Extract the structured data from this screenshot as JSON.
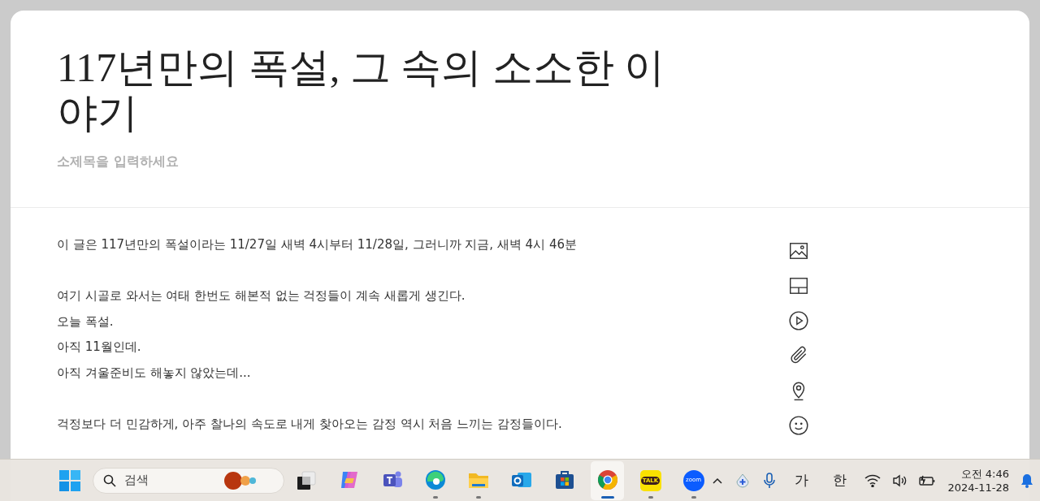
{
  "editor": {
    "title": "117년만의 폭설, 그 속의 소소한 이야기",
    "subtitle_placeholder": "소제목을 입력하세요",
    "paragraphs": [
      [
        "이 글은 117년만의 폭설이라는 11/27일 새벽 4시부터 11/28일, 그러니까 지금, 새벽 4시 46분"
      ],
      [
        "여기 시골로 와서는 여태 한번도 해본적 없는 걱정들이 계속 새롭게 생긴다.",
        "오늘 폭설.",
        "아직 11월인데.",
        "아직 겨울준비도 해놓지 않았는데..."
      ],
      [
        "걱정보다 더 민감하게, 아주 찰나의 속도로 내게 찾아오는 감정 역시 처음 느끼는 감정들이다."
      ]
    ]
  },
  "taskbar": {
    "search_placeholder": "검색",
    "apps": [
      {
        "kind": "taskview",
        "running": false,
        "selected": false
      },
      {
        "kind": "copilot",
        "running": false,
        "selected": false
      },
      {
        "kind": "teams",
        "running": false,
        "selected": false
      },
      {
        "kind": "edge",
        "running": true,
        "selected": false
      },
      {
        "kind": "explorer",
        "running": true,
        "selected": false
      },
      {
        "kind": "outlook",
        "running": false,
        "selected": false
      },
      {
        "kind": "store",
        "running": false,
        "selected": false
      },
      {
        "kind": "chrome",
        "running": true,
        "selected": true
      },
      {
        "kind": "kakao",
        "label": "TALK",
        "running": true,
        "selected": false
      },
      {
        "kind": "zoom",
        "label": "zoom",
        "running": true,
        "selected": false
      }
    ],
    "ime": [
      "가",
      "한"
    ],
    "time": "오전 4:46",
    "date": "2024-11-28"
  }
}
